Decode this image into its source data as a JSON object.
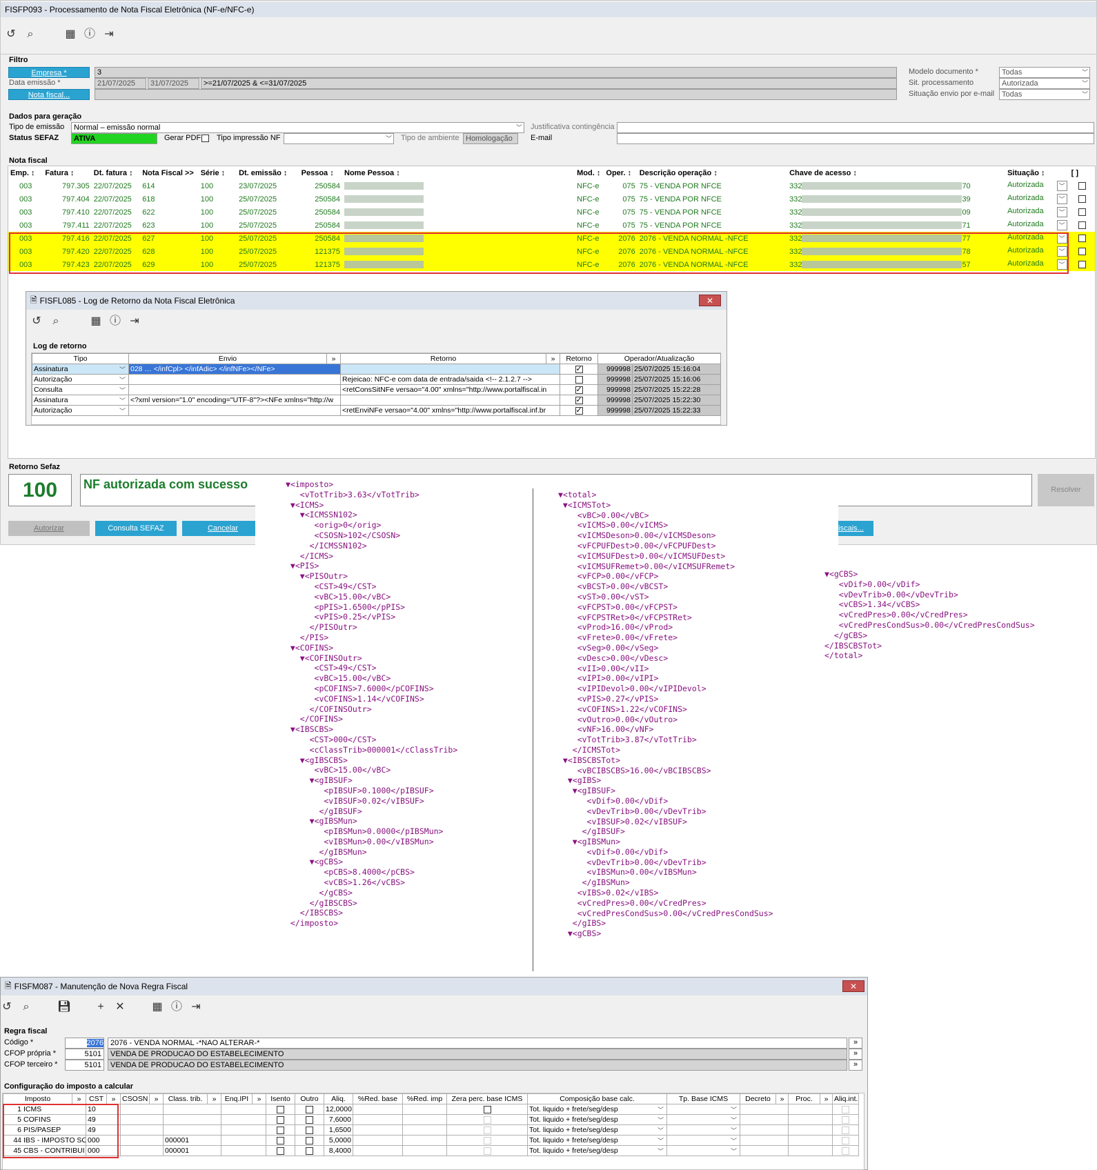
{
  "main_window": {
    "title": "FISFP093 - Processamento de Nota Fiscal Eletrônica (NF-e/NFC-e)",
    "filtro": {
      "section": "Filtro",
      "empresa_btn": "Empresa *",
      "empresa_value": "3",
      "data_emissao_label": "Data emissão *",
      "data_from": "21/07/2025",
      "data_to": "31/07/2025",
      "data_expr": ">=21/07/2025 & <=31/07/2025",
      "nota_btn": "Nota fiscal...",
      "modelo_label": "Modelo documento *",
      "modelo_value": "Todas",
      "sit_label": "Sit. processamento",
      "sit_value": "Autorizada",
      "envio_label": "Situação envio por e-mail",
      "envio_value": "Todas"
    },
    "dados": {
      "section": "Dados para geração",
      "tipo_emissao_label": "Tipo de emissão",
      "tipo_emissao_value": "Normal – emissão normal",
      "status_label": "Status SEFAZ",
      "status_value": "ATIVA",
      "gerar_pdf_label": "Gerar PDF",
      "tipo_impressao_label": "Tipo impressão NF",
      "tipo_ambiente_label": "Tipo de ambiente",
      "tipo_ambiente_value": "Homologação",
      "justificativa_label": "Justificativa contingência",
      "email_label": "E-mail"
    },
    "nota_fiscal": {
      "section": "Nota fiscal",
      "headers": [
        "Emp. ↕",
        "Fatura ↕",
        "Dt. fatura ↕",
        "Nota Fiscal >>",
        "Série ↕",
        "Dt. emissão ↕",
        "Pessoa ↕",
        "Nome Pessoa ↕",
        "Mod. ↕",
        "Oper. ↕",
        "Descrição operação ↕",
        "Chave de acesso ↕",
        "Situação ↕",
        "[ ]"
      ],
      "rows": [
        {
          "emp": "003",
          "fatura": "797.305",
          "dt_fatura": "22/07/2025",
          "nf": "614",
          "serie": "100",
          "dt_emissao": "23/07/2025",
          "pessoa": "250584",
          "mod": "NFC-e",
          "oper": "075",
          "desc": "75 - VENDA POR NFCE",
          "chave_ini": "332",
          "chave_fim": "70",
          "situacao": "Autorizada",
          "hl": false
        },
        {
          "emp": "003",
          "fatura": "797.404",
          "dt_fatura": "22/07/2025",
          "nf": "618",
          "serie": "100",
          "dt_emissao": "25/07/2025",
          "pessoa": "250584",
          "mod": "NFC-e",
          "oper": "075",
          "desc": "75 - VENDA POR NFCE",
          "chave_ini": "332",
          "chave_fim": "39",
          "situacao": "Autorizada",
          "hl": false
        },
        {
          "emp": "003",
          "fatura": "797.410",
          "dt_fatura": "22/07/2025",
          "nf": "622",
          "serie": "100",
          "dt_emissao": "25/07/2025",
          "pessoa": "250584",
          "mod": "NFC-e",
          "oper": "075",
          "desc": "75 - VENDA POR NFCE",
          "chave_ini": "332",
          "chave_fim": "09",
          "situacao": "Autorizada",
          "hl": false
        },
        {
          "emp": "003",
          "fatura": "797.411",
          "dt_fatura": "22/07/2025",
          "nf": "623",
          "serie": "100",
          "dt_emissao": "25/07/2025",
          "pessoa": "250584",
          "mod": "NFC-e",
          "oper": "075",
          "desc": "75 - VENDA POR NFCE",
          "chave_ini": "332",
          "chave_fim": "71",
          "situacao": "Autorizada",
          "hl": false
        },
        {
          "emp": "003",
          "fatura": "797.416",
          "dt_fatura": "22/07/2025",
          "nf": "627",
          "serie": "100",
          "dt_emissao": "25/07/2025",
          "pessoa": "250584",
          "mod": "NFC-e",
          "oper": "2076",
          "desc": "2076 - VENDA NORMAL -NFCE",
          "chave_ini": "332",
          "chave_fim": "77",
          "situacao": "Autorizada",
          "hl": true
        },
        {
          "emp": "003",
          "fatura": "797.420",
          "dt_fatura": "22/07/2025",
          "nf": "628",
          "serie": "100",
          "dt_emissao": "25/07/2025",
          "pessoa": "121375",
          "mod": "NFC-e",
          "oper": "2076",
          "desc": "2076 - VENDA NORMAL -NFCE",
          "chave_ini": "332",
          "chave_fim": "78",
          "situacao": "Autorizada",
          "hl": true
        },
        {
          "emp": "003",
          "fatura": "797.423",
          "dt_fatura": "22/07/2025",
          "nf": "629",
          "serie": "100",
          "dt_emissao": "25/07/2025",
          "pessoa": "121375",
          "mod": "NFC-e",
          "oper": "2076",
          "desc": "2076 - VENDA NORMAL -NFCE",
          "chave_ini": "332",
          "chave_fim": "57",
          "situacao": "Autorizada",
          "hl": true
        }
      ]
    },
    "retorno": {
      "section": "Retorno Sefaz",
      "code": "100",
      "message": "NF autorizada com sucesso",
      "resolver": "Resolver"
    },
    "buttons": {
      "autorizar": "Autorizar",
      "consulta": "Consulta SEFAZ",
      "cancelar": "Cancelar",
      "fiscais": "iscais..."
    }
  },
  "log_window": {
    "title": "FISFL085 - Log de Retorno da Nota Fiscal Eletrônica",
    "section": "Log de retorno",
    "headers": [
      "Tipo",
      "Envio",
      "»",
      "Retorno",
      "»",
      "Retorno",
      "Operador/Atualização"
    ],
    "rows": [
      {
        "tipo": "Assinatura",
        "envio": "028 … </infCpl>  </infAdic> </infNFe></NFe>",
        "retorno": "",
        "chk": true,
        "op": "999998",
        "dt": "25/07/2025 15:16:04",
        "sel": true
      },
      {
        "tipo": "Autorização",
        "envio": "",
        "retorno": "Rejeicao: NFC-e com data de entrada/saida <!--  2.1.2.7 -->",
        "chk": false,
        "op": "999998",
        "dt": "25/07/2025 15:16:06",
        "sel": false
      },
      {
        "tipo": "Consulta",
        "envio": "",
        "retorno": "<retConsSitNFe versao=\"4.00\" xmlns=\"http://www.portalfiscal.in",
        "chk": true,
        "op": "999998",
        "dt": "25/07/2025 15:22:28",
        "sel": false
      },
      {
        "tipo": "Assinatura",
        "envio": "<?xml version=\"1.0\" encoding=\"UTF-8\"?><NFe xmlns=\"http://w",
        "retorno": "",
        "chk": true,
        "op": "999998",
        "dt": "25/07/2025 15:22:30",
        "sel": false
      },
      {
        "tipo": "Autorização",
        "envio": "",
        "retorno": "<retEnviNFe versao=\"4.00\" xmlns=\"http://www.portalfiscal.inf.br",
        "chk": true,
        "op": "999998",
        "dt": "25/07/2025 15:22:33",
        "sel": false
      }
    ]
  },
  "xml_left": "▼<imposto>\n   <vTotTrib>3.63</vTotTrib>\n ▼<ICMS>\n   ▼<ICMSSN102>\n      <orig>0</orig>\n      <CSOSN>102</CSOSN>\n     </ICMSSN102>\n   </ICMS>\n ▼<PIS>\n   ▼<PISOutr>\n      <CST>49</CST>\n      <vBC>15.00</vBC>\n      <pPIS>1.6500</pPIS>\n      <vPIS>0.25</vPIS>\n     </PISOutr>\n   </PIS>\n ▼<COFINS>\n   ▼<COFINSOutr>\n      <CST>49</CST>\n      <vBC>15.00</vBC>\n      <pCOFINS>7.6000</pCOFINS>\n      <vCOFINS>1.14</vCOFINS>\n     </COFINSOutr>\n   </COFINS>\n ▼<IBSCBS>\n     <CST>000</CST>\n     <cClassTrib>000001</cClassTrib>\n   ▼<gIBSCBS>\n      <vBC>15.00</vBC>\n     ▼<gIBSUF>\n        <pIBSUF>0.1000</pIBSUF>\n        <vIBSUF>0.02</vIBSUF>\n       </gIBSUF>\n     ▼<gIBSMun>\n        <pIBSMun>0.0000</pIBSMun>\n        <vIBSMun>0.00</vIBSMun>\n       </gIBSMun>\n     ▼<gCBS>\n        <pCBS>8.4000</pCBS>\n        <vCBS>1.26</vCBS>\n       </gCBS>\n     </gIBSCBS>\n   </IBSCBS>\n </imposto>",
  "xml_right": "▼<total>\n ▼<ICMSTot>\n    <vBC>0.00</vBC>\n    <vICMS>0.00</vICMS>\n    <vICMSDeson>0.00</vICMSDeson>\n    <vFCPUFDest>0.00</vFCPUFDest>\n    <vICMSUFDest>0.00</vICMSUFDest>\n    <vICMSUFRemet>0.00</vICMSUFRemet>\n    <vFCP>0.00</vFCP>\n    <vBCST>0.00</vBCST>\n    <vST>0.00</vST>\n    <vFCPST>0.00</vFCPST>\n    <vFCPSTRet>0</vFCPSTRet>\n    <vProd>16.00</vProd>\n    <vFrete>0.00</vFrete>\n    <vSeg>0.00</vSeg>\n    <vDesc>0.00</vDesc>\n    <vII>0.00</vII>\n    <vIPI>0.00</vIPI>\n    <vIPIDevol>0.00</vIPIDevol>\n    <vPIS>0.27</vPIS>\n    <vCOFINS>1.22</vCOFINS>\n    <vOutro>0.00</vOutro>\n    <vNF>16.00</vNF>\n    <vTotTrib>3.87</vTotTrib>\n   </ICMSTot>\n ▼<IBSCBSTot>\n    <vBCIBSCBS>16.00</vBCIBSCBS>\n  ▼<gIBS>\n   ▼<gIBSUF>\n      <vDif>0.00</vDif>\n      <vDevTrib>0.00</vDevTrib>\n      <vIBSUF>0.02</vIBSUF>\n     </gIBSUF>\n   ▼<gIBSMun>\n      <vDif>0.00</vDif>\n      <vDevTrib>0.00</vDevTrib>\n      <vIBSMun>0.00</vIBSMun>\n     </gIBSMun>\n    <vIBS>0.02</vIBS>\n    <vCredPres>0.00</vCredPres>\n    <vCredPresCondSus>0.00</vCredPresCondSus>\n   </gIBS>\n  ▼<gCBS>",
  "xml_right2": "▼<gCBS>\n   <vDif>0.00</vDif>\n   <vDevTrib>0.00</vDevTrib>\n   <vCBS>1.34</vCBS>\n   <vCredPres>0.00</vCredPres>\n   <vCredPresCondSus>0.00</vCredPresCondSus>\n  </gCBS>\n</IBSCBSTot>\n</total>",
  "regra_window": {
    "title": "FISFM087 - Manutenção de Nova Regra Fiscal",
    "section": "Regra fiscal",
    "codigo_label": "Código *",
    "codigo_value": "2076",
    "codigo_desc": "2076 - VENDA NORMAL -*NAO ALTERAR-*",
    "cfop_propria_label": "CFOP própria *",
    "cfop_propria_value": "5101",
    "cfop_propria_desc": "VENDA DE PRODUCAO DO ESTABELECIMENTO",
    "cfop_terceiro_label": "CFOP terceiro *",
    "cfop_terceiro_value": "5101",
    "cfop_terceiro_desc": "VENDA DE PRODUCAO DO ESTABELECIMENTO",
    "config_section": "Configuração do imposto a calcular",
    "headers": [
      "Imposto",
      "»",
      "CST",
      "»",
      "CSOSN",
      "»",
      "Class. trib.",
      "»",
      "Enq.IPI",
      "»",
      "Isento",
      "Outro",
      "Aliq.",
      "%Red. base",
      "%Red. imp",
      "Zera perc. base ICMS",
      "Composição base calc.",
      "Tp. Base ICMS",
      "Decreto",
      "»",
      "Proc.",
      "»",
      "Aliq.int."
    ],
    "rows": [
      {
        "n": "1",
        "imposto": "ICMS",
        "cst": "10",
        "class": "",
        "aliq": "12,0000",
        "comp": "Tot. liquido + frete/seg/desp"
      },
      {
        "n": "5",
        "imposto": "COFINS",
        "cst": "49",
        "class": "",
        "aliq": "7,6000",
        "comp": "Tot. liquido + frete/seg/desp"
      },
      {
        "n": "6",
        "imposto": "PIS/PASEP",
        "cst": "49",
        "class": "",
        "aliq": "1,6500",
        "comp": "Tot. liquido + frete/seg/desp"
      },
      {
        "n": "44",
        "imposto": "IBS - IMPOSTO SO",
        "cst": "000",
        "class": "000001",
        "aliq": "5,0000",
        "comp": "Tot. liquido + frete/seg/desp"
      },
      {
        "n": "45",
        "imposto": "CBS - CONTRIBUI",
        "cst": "000",
        "class": "000001",
        "aliq": "8,4000",
        "comp": "Tot. liquido + frete/seg/desp"
      }
    ]
  }
}
